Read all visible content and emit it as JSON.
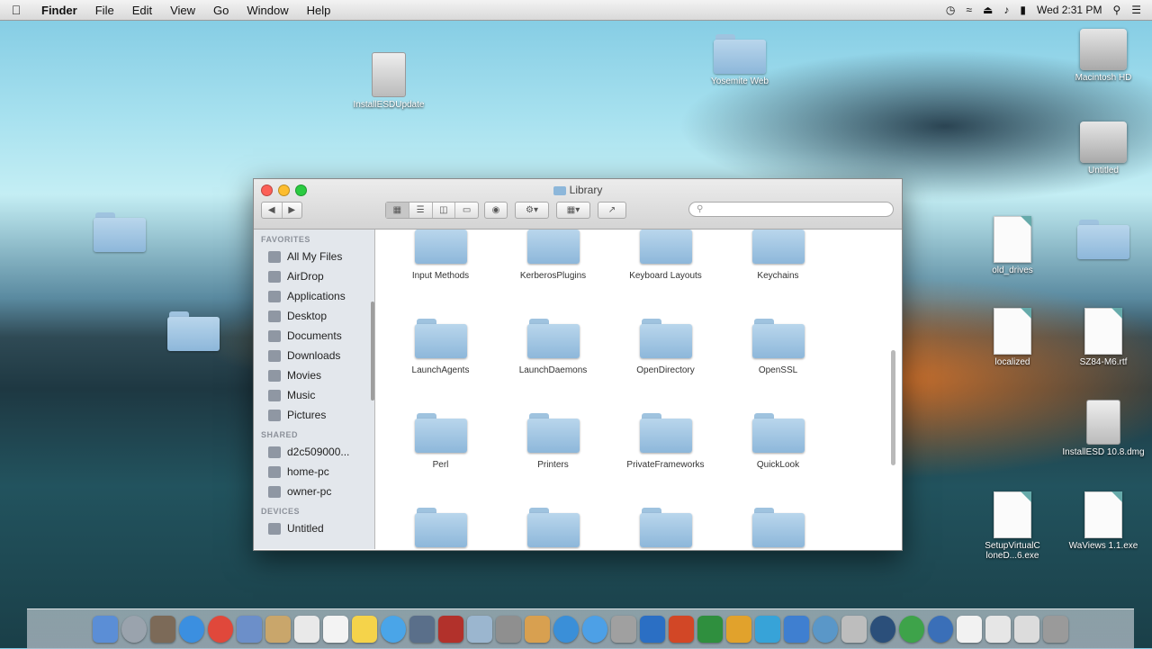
{
  "menubar": {
    "apple": "",
    "items": [
      "Finder",
      "File",
      "Edit",
      "View",
      "Go",
      "Window",
      "Help"
    ],
    "clock": "Wed 2:31 PM",
    "status_icons": [
      "time-machine-icon",
      "wifi-icon",
      "eject-icon",
      "volume-icon",
      "battery-icon"
    ]
  },
  "desktop": {
    "icons": [
      {
        "label": "Macintosh HD",
        "kind": "disk"
      },
      {
        "label": "Untitled",
        "kind": "disk"
      },
      {
        "label": "Yosemite Web",
        "kind": "folder"
      },
      {
        "label": "InstallESDUpdate",
        "kind": "doc"
      },
      {
        "label": "old_drives",
        "kind": "doc"
      },
      {
        "label": "localized",
        "kind": "doc"
      },
      {
        "label": "SZ84-M6.rtf",
        "kind": "doc"
      },
      {
        "label": "InstallESD 10.8.dmg",
        "kind": "dmg"
      },
      {
        "label": "SetupVirtualC loneD...6.exe",
        "kind": "doc"
      },
      {
        "label": "WaViews 1.1.exe",
        "kind": "doc"
      }
    ]
  },
  "window": {
    "title": "Library",
    "search_placeholder": "",
    "sidebar": {
      "favorites_header": "FAVORITES",
      "favorites": [
        "All My Files",
        "AirDrop",
        "Applications",
        "Desktop",
        "Documents",
        "Downloads",
        "Movies",
        "Music",
        "Pictures"
      ],
      "shared_header": "SHARED",
      "shared": [
        "d2c509000...",
        "home-pc",
        "owner-pc"
      ],
      "devices_header": "DEVICES",
      "devices": [
        "Untitled"
      ]
    },
    "items": [
      "Input Methods",
      "KerberosPlugins",
      "Keyboard Layouts",
      "Keychains",
      "LaunchAgents",
      "LaunchDaemons",
      "OpenDirectory",
      "OpenSSL",
      "Perl",
      "Printers",
      "PrivateFrameworks",
      "QuickLook",
      "",
      "",
      "",
      ""
    ]
  },
  "colors": {
    "close": "#fc5f57",
    "minimize": "#fdbd2e",
    "zoom": "#2acb41",
    "folder": "#8db7da"
  }
}
